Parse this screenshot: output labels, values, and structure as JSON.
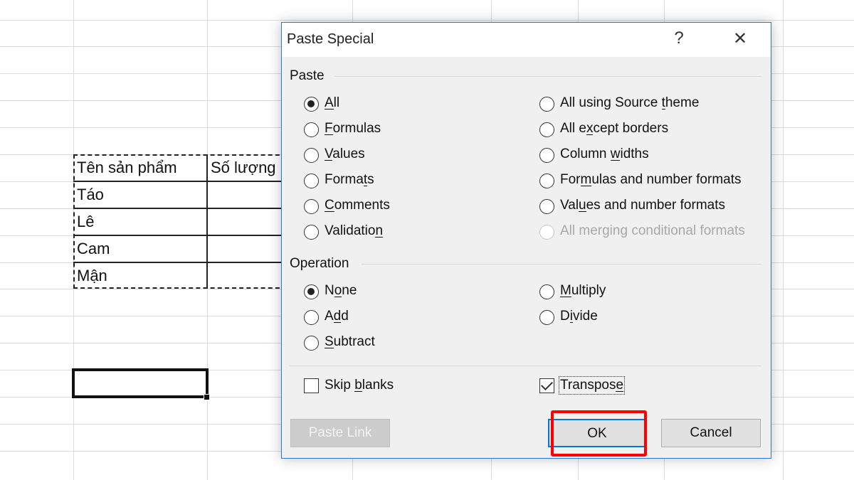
{
  "sheet": {
    "table": {
      "header": [
        "Tên sản phẩm",
        "Số lượng"
      ],
      "rows": [
        "Táo",
        "Lê",
        "Cam",
        "Mận"
      ]
    }
  },
  "dialog": {
    "title": "Paste Special",
    "help_label": "?",
    "close_label": "✕",
    "paste_group": "Paste",
    "paste_left": [
      {
        "label": "All",
        "u": 0,
        "checked": true
      },
      {
        "label": "Formulas",
        "u": 0
      },
      {
        "label": "Values",
        "u": 0
      },
      {
        "label": "Formats",
        "u": 5
      },
      {
        "label": "Comments",
        "u": 0
      },
      {
        "label": "Validation",
        "u": 9
      }
    ],
    "paste_right": [
      {
        "label": "All using Source theme",
        "u": 17
      },
      {
        "label": "All except borders",
        "u": 5
      },
      {
        "label": "Column widths",
        "u": 7
      },
      {
        "label": "Formulas and number formats",
        "u": 3
      },
      {
        "label": "Values and number formats",
        "u": 3
      },
      {
        "label": "All merging conditional formats",
        "u": -1,
        "disabled": true
      }
    ],
    "operation_group": "Operation",
    "op_left": [
      {
        "label": "None",
        "u": 1,
        "checked": true
      },
      {
        "label": "Add",
        "u": 1
      },
      {
        "label": "Subtract",
        "u": 0
      }
    ],
    "op_right": [
      {
        "label": "Multiply",
        "u": 0
      },
      {
        "label": "Divide",
        "u": 1
      }
    ],
    "skip_blanks": {
      "label": "Skip blanks",
      "u": 5,
      "checked": false
    },
    "transpose": {
      "label": "Transpose",
      "u": 8,
      "checked": true
    },
    "paste_link_label": "Paste Link",
    "ok_label": "OK",
    "cancel_label": "Cancel"
  },
  "colors": {
    "accent": "#0078d7",
    "highlight": "#ff0000"
  }
}
